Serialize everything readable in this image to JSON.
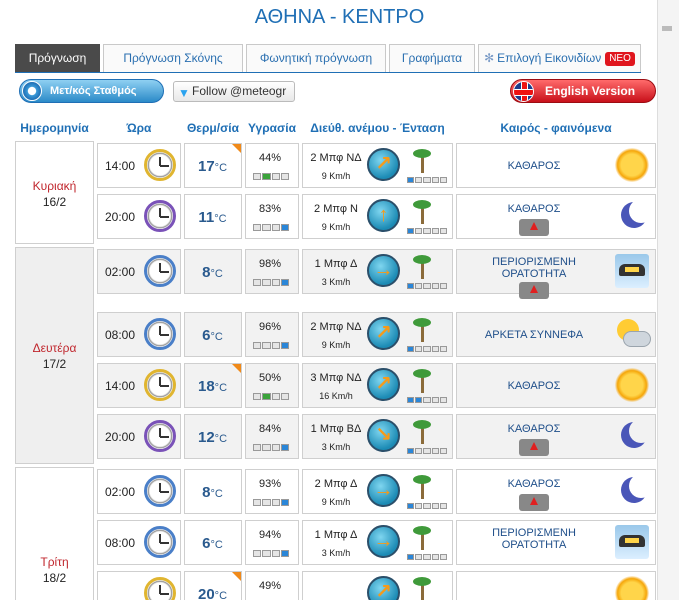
{
  "page": {
    "title": "ΑΘΗΝΑ - ΚΕΝΤΡΟ"
  },
  "tabs": [
    {
      "label": "Πρόγνωση",
      "active": true
    },
    {
      "label": "Πρόγνωση Σκόνης",
      "active": false
    },
    {
      "label": "Φωνητική πρόγνωση",
      "active": false
    },
    {
      "label": "Γραφήματα",
      "active": false
    },
    {
      "label": "Επιλογή Εικονιδίων",
      "badge": "NEO",
      "active": false
    }
  ],
  "buttons": {
    "stations": "Μετ/κός Σταθμός",
    "twitter": "Follow @meteogr",
    "english": "English Version"
  },
  "headers": {
    "date": "Ημερομηνία",
    "hour": "Ώρα",
    "temp": "Θερμ/σία",
    "humidity": "Υγρασία",
    "wind": "Διεύθ. ανέμου - Ένταση",
    "weather": "Καιρός - φαινόμενα"
  },
  "units": {
    "temp": "°C",
    "wind_speed": "Km/h"
  },
  "days": [
    {
      "name": "Κυριακή",
      "date": "16/2"
    },
    {
      "name": "Δευτέρα",
      "date": "17/2"
    },
    {
      "name": "Τρίτη",
      "date": "18/2"
    }
  ],
  "rows": [
    {
      "time": "14:00",
      "clock": "day",
      "temp": "17",
      "hot": true,
      "humidity": "44%",
      "hum_level": 2,
      "wind": "2 Μπφ ΝΔ",
      "kmh": "9 Km/h",
      "arrow": "↗",
      "wbars": 1,
      "condition": "ΚΑΘΑΡΟΣ",
      "badge": false,
      "icon": "sun-icon"
    },
    {
      "time": "20:00",
      "clock": "night",
      "temp": "11",
      "hot": false,
      "humidity": "83%",
      "hum_level": 4,
      "wind": "2 Μπφ Ν",
      "kmh": "9 Km/h",
      "arrow": "↑",
      "wbars": 1,
      "condition": "ΚΑΘΑΡΟΣ",
      "badge": true,
      "icon": "moon-icon"
    },
    {
      "time": "02:00",
      "clock": "morning",
      "temp": "8",
      "hot": false,
      "humidity": "98%",
      "hum_level": 4,
      "wind": "1 Μπφ Δ",
      "kmh": "3 Km/h",
      "arrow": "→",
      "wbars": 1,
      "condition": "ΠΕΡΙΟΡΙΣΜΕΝΗ ΟΡΑΤΟΤΗΤΑ",
      "badge": true,
      "icon": "car-icon"
    },
    {
      "time": "08:00",
      "clock": "morning",
      "temp": "6",
      "hot": false,
      "humidity": "96%",
      "hum_level": 4,
      "wind": "2 Μπφ ΝΔ",
      "kmh": "9 Km/h",
      "arrow": "↗",
      "wbars": 1,
      "condition": "ΑΡΚΕΤΑ ΣΥΝΝΕΦΑ",
      "badge": false,
      "icon": "cloud-icon"
    },
    {
      "time": "14:00",
      "clock": "day",
      "temp": "18",
      "hot": true,
      "humidity": "50%",
      "hum_level": 2,
      "wind": "3 Μπφ ΝΔ",
      "kmh": "16 Km/h",
      "arrow": "↗",
      "wbars": 2,
      "condition": "ΚΑΘΑΡΟΣ",
      "badge": false,
      "icon": "sun-icon"
    },
    {
      "time": "20:00",
      "clock": "night",
      "temp": "12",
      "hot": false,
      "humidity": "84%",
      "hum_level": 4,
      "wind": "1 Μπφ ΒΔ",
      "kmh": "3 Km/h",
      "arrow": "↘",
      "wbars": 1,
      "condition": "ΚΑΘΑΡΟΣ",
      "badge": true,
      "icon": "moon-icon"
    },
    {
      "time": "02:00",
      "clock": "morning",
      "temp": "8",
      "hot": false,
      "humidity": "93%",
      "hum_level": 4,
      "wind": "2 Μπφ Δ",
      "kmh": "9 Km/h",
      "arrow": "→",
      "wbars": 1,
      "condition": "ΚΑΘΑΡΟΣ",
      "badge": true,
      "icon": "moon-icon"
    },
    {
      "time": "08:00",
      "clock": "morning",
      "temp": "6",
      "hot": false,
      "humidity": "94%",
      "hum_level": 4,
      "wind": "1 Μπφ Δ",
      "kmh": "3 Km/h",
      "arrow": "→",
      "wbars": 1,
      "condition": "ΠΕΡΙΟΡΙΣΜΕΝΗ ΟΡΑΤΟΤΗΤΑ",
      "badge": false,
      "icon": "car-icon"
    },
    {
      "time": "",
      "clock": "day",
      "temp": "20",
      "hot": true,
      "humidity": "49%",
      "hum_level": 2,
      "wind": "",
      "kmh": "",
      "arrow": "↗",
      "wbars": 1,
      "condition": "",
      "badge": false,
      "icon": "sun-icon"
    }
  ]
}
